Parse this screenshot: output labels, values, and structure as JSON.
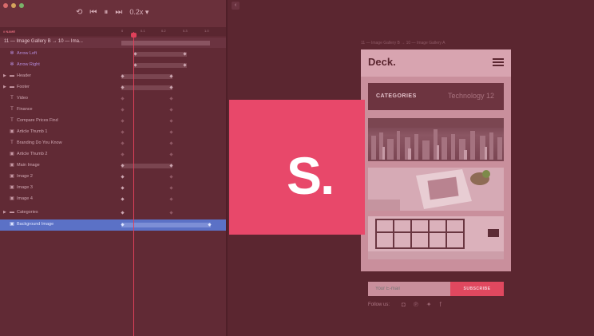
{
  "timeline": {
    "speed": "0.2x",
    "ruler_label": "# NAME",
    "ticks": [
      "0",
      "0.1",
      "0.2",
      "0.3",
      "1.0"
    ],
    "sequence_title": "11 — Image Gallery B → 10 — Ima...",
    "rows": [
      {
        "label": "Arrow Left",
        "icon": "gear-icon"
      },
      {
        "label": "Arrow Right",
        "icon": "gear-icon"
      },
      {
        "label": "Header",
        "icon": "folder-icon"
      },
      {
        "label": "Footer",
        "icon": "folder-icon"
      },
      {
        "label": "Video",
        "icon": "text-icon"
      },
      {
        "label": "Finance",
        "icon": "text-icon"
      },
      {
        "label": "Compare Prices Find",
        "icon": "text-icon"
      },
      {
        "label": "Article Thumb 1",
        "icon": "image-icon"
      },
      {
        "label": "Branding Do You Know",
        "icon": "text-icon"
      },
      {
        "label": "Article Thumb 2",
        "icon": "image-icon"
      },
      {
        "label": "Main Image",
        "icon": "image-icon"
      },
      {
        "label": "Image 2",
        "icon": "image-icon"
      },
      {
        "label": "Image 3",
        "icon": "image-icon"
      },
      {
        "label": "Image 4",
        "icon": "image-icon"
      },
      {
        "label": "Categories",
        "icon": "folder-icon"
      },
      {
        "label": "Background Image",
        "icon": "image-icon"
      }
    ]
  },
  "preview": {
    "breadcrumb": "11 — Image Gallery B → 10 — Image Gallery A",
    "logo": "Deck.",
    "category_label": "CATEGORIES",
    "category_value": "Technology 12",
    "email_placeholder": "Your E-mail",
    "subscribe_label": "SUBSCRIBE",
    "follow_label": "Follow us:"
  },
  "brand": {
    "logo_text": "S.",
    "accent_color": "#e8486a"
  }
}
